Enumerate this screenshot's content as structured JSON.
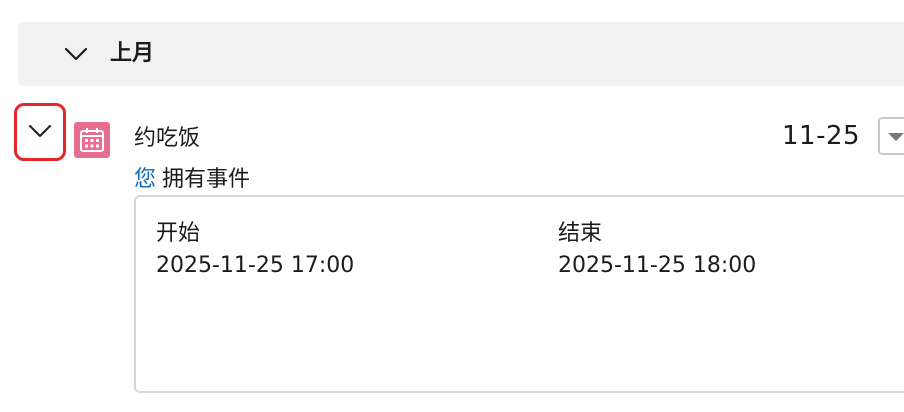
{
  "group": {
    "title": "上月"
  },
  "event": {
    "title": "约吃饭",
    "date": "11-25",
    "owner_you": "您",
    "owner_text": "拥有事件",
    "start_label": "开始",
    "start_value": "2025-11-25 17:00",
    "end_label": "结束",
    "end_value": "2025-11-25 18:00",
    "icon": "calendar-icon",
    "icon_color": "#e86e8f"
  },
  "colors": {
    "accent_link": "#0f6cbd",
    "highlight_border": "#e5262a",
    "header_bg": "#f1f1f1"
  }
}
